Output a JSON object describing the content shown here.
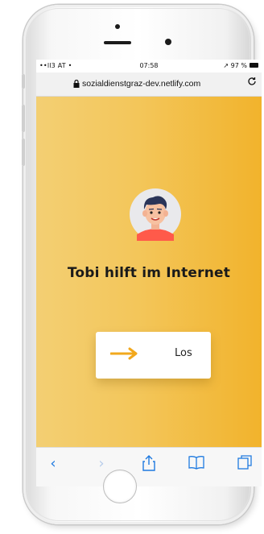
{
  "status_bar": {
    "carrier": "••ll3 AT •",
    "time": "07:58",
    "battery": "↗ 97 %"
  },
  "browser": {
    "url": "sozialdienstgraz-dev.netlify.com",
    "lock_icon": "lock-icon",
    "reload_icon": "reload-icon"
  },
  "page": {
    "headline": "Tobi hilft im Internet",
    "cta_label": "Los"
  },
  "toolbar": {
    "back": "‹",
    "forward": "›",
    "share": "⇪",
    "bookmarks": "☗",
    "tabs": "☐"
  },
  "colors": {
    "accent": "#f4b93a",
    "arrow": "#f2a81d",
    "link": "#1f7ae0"
  }
}
